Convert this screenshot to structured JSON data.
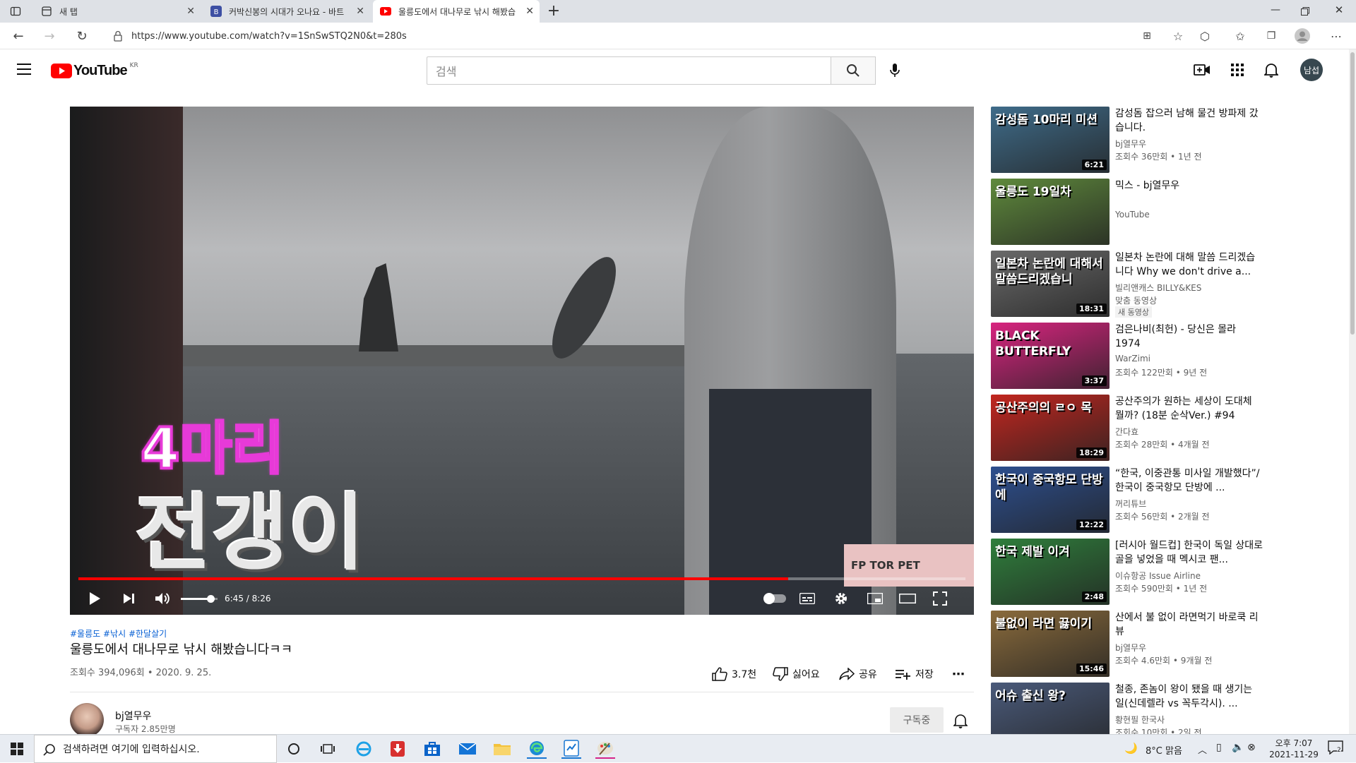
{
  "browser": {
    "tabs": [
      {
        "label": "새 탭",
        "active": false
      },
      {
        "label": "커박신봉의 시대가 오나요 - 바트",
        "active": false
      },
      {
        "label": "울릉도에서 대나무로 낚시 해봤습",
        "active": true
      }
    ],
    "url": "https://www.youtube.com/watch?v=1SnSwSTQ2N0&t=280s"
  },
  "youtube": {
    "logo_text": "YouTube",
    "region": "KR",
    "search_placeholder": "검색",
    "avatar_text": "남섭"
  },
  "video": {
    "overlay_line1": "4마리",
    "overlay_line2": "전갱이",
    "watermark": "FP TOR PET",
    "time": "6:45 / 8:26",
    "progress": 0.8,
    "volume": 0.8
  },
  "details": {
    "hashtags": "#울릉도 #낚시 #한달살기",
    "title": "울릉도에서 대나무로 낚시 해봤습니다ㅋㅋ",
    "views_date": "조회수 394,096회 • 2020. 9. 25.",
    "likes": "3.7천",
    "dislike": "싫어요",
    "share": "공유",
    "save": "저장",
    "channel_name": "bj열무우",
    "subscribers": "구독자 2.85만명",
    "subscribe_label": "구독중"
  },
  "recommendations": [
    {
      "title": "감성돔 잡으러 남해 물건 방파제 갔습니다.",
      "channel": "bj열무우",
      "stats": "조회수 36만회 • 1년 전",
      "duration": "6:21",
      "thumb_text": "감성돔 10마리 미션",
      "thumb_color": "#3f6c8a"
    },
    {
      "title": "믹스 - bj열무우",
      "channel": "YouTube",
      "stats": "",
      "duration": "",
      "thumb_text": "울릉도 19일차",
      "thumb_color": "#5f8a3c"
    },
    {
      "title": "일본차 논란에 대해 말씀 드리겠습니다 Why we don't drive a...",
      "channel": "빌리앤캐스 BILLY&KES",
      "stats": "맞춤 동영상",
      "badge": "새 동영상",
      "duration": "18:31",
      "thumb_text": "일본차 논란에 대해서 말씀드리겠습니",
      "thumb_color": "#6a6a6a"
    },
    {
      "title": "검은나비(최헌) - 당신은 몰라 1974",
      "channel": "WarZimi",
      "stats": "조회수 122만회 • 9년 전",
      "duration": "3:37",
      "thumb_text": "BLACK BUTTERFLY",
      "thumb_color": "#d8247f"
    },
    {
      "title": "공산주의가 원하는 세상이 도대체 뭘까? (18분 순삭Ver.) #94",
      "channel": "간다효",
      "stats": "조회수 28만회 • 4개월 전",
      "duration": "18:29",
      "thumb_text": "공산주의의 ㄹㅇ 목",
      "thumb_color": "#c2261f"
    },
    {
      "title": "“한국, 이중관통 미사일 개발했다”/ 한국이 중국항모 단방에 ...",
      "channel": "꺼리튜브",
      "stats": "조회수 56만회 • 2개월 전",
      "duration": "12:22",
      "thumb_text": "한국이 중국항모 단방에",
      "thumb_color": "#2d4f8f"
    },
    {
      "title": "[러시아 월드컵] 한국이 독일 상대로 골을 넣었을 때 멕시코 팬...",
      "channel": "이슈항공 Issue Airline",
      "stats": "조회수 590만회 • 1년 전",
      "duration": "2:48",
      "thumb_text": "한국 제발 이겨",
      "thumb_color": "#2f7f3c"
    },
    {
      "title": "산에서 불 없이 라면먹기 바로쿡 리뷰",
      "channel": "bj열무우",
      "stats": "조회수 4.6만회 • 9개월 전",
      "duration": "15:46",
      "thumb_text": "불없이 라면 끓이기",
      "thumb_color": "#8a6b3c"
    },
    {
      "title": "철종, 존놈이 왕이 됐을 때 생기는 일(신데렐라 vs 꼭두각시). ...",
      "channel": "황현필 한국사",
      "stats": "조회수 10만회 • 2일 전",
      "duration": "",
      "thumb_text": "어슈 출신 왕?",
      "thumb_color": "#4a5a7a"
    }
  ],
  "taskbar": {
    "search_placeholder": "검색하려면 여기에 입력하십시오.",
    "weather": "8°C  맑음",
    "time": "오후 7:07",
    "date": "2021-11-29",
    "notifications": "2"
  }
}
